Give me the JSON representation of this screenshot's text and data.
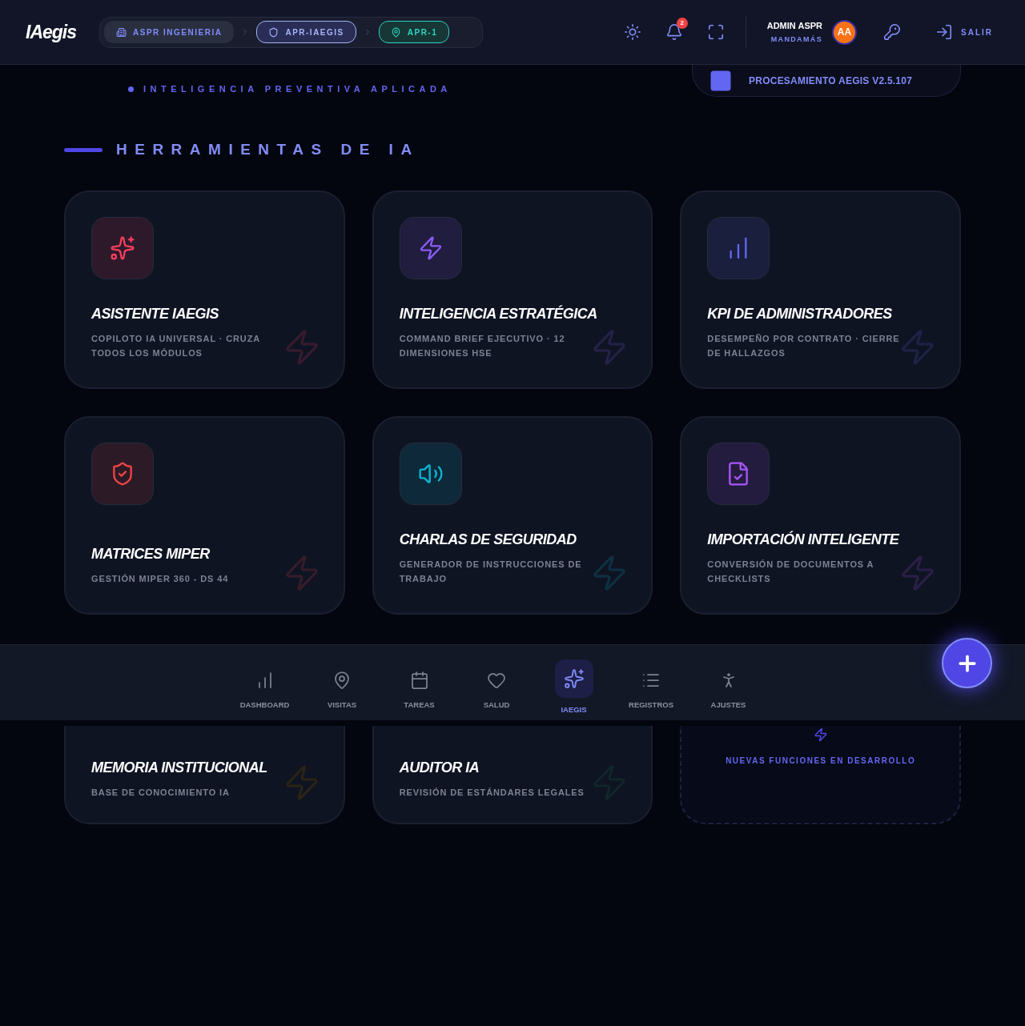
{
  "header": {
    "logo": "IAegis",
    "breadcrumbs": [
      {
        "label": "ASPR INGENIERIA",
        "kind": "company"
      },
      {
        "label": "APR-IAEGIS",
        "kind": "module"
      },
      {
        "label": "APR-1",
        "kind": "site"
      }
    ],
    "notifications": "2",
    "user": {
      "name": "ADMIN ASPR",
      "role": "MANDAMÁS",
      "initials": "AA"
    },
    "logout": "SALIR"
  },
  "tagline": "INTELIGENCIA PREVENTIVA APLICADA",
  "status_card": {
    "text": "PROCESAMIENTO AEGIS V2.5.107"
  },
  "section_title": "HERRAMIENTAS DE IA",
  "tools": [
    {
      "title": "ASISTENTE IAEGIS",
      "subtitle": "COPILOTO IA UNIVERSAL · CRUZA TODOS LOS MÓDULOS",
      "color": "#f43f5e"
    },
    {
      "title": "INTELIGENCIA ESTRATÉGICA",
      "subtitle": "COMMAND BRIEF EJECUTIVO · 12 DIMENSIONES HSE",
      "color": "#8b5cf6"
    },
    {
      "title": "KPI DE ADMINISTRADORES",
      "subtitle": "DESEMPEÑO POR CONTRATO · CIERRE DE HALLAZGOS",
      "color": "#6366f1"
    },
    {
      "title": "MATRICES MIPER",
      "subtitle": "GESTIÓN MIPER 360 - DS 44",
      "color": "#ef4444"
    },
    {
      "title": "CHARLAS DE SEGURIDAD",
      "subtitle": "GENERADOR DE INSTRUCCIONES DE TRABAJO",
      "color": "#06b6d4"
    },
    {
      "title": "IMPORTACIÓN INTELIGENTE",
      "subtitle": "CONVERSIÓN DE DOCUMENTOS A CHECKLISTS",
      "color": "#a855f7"
    },
    {
      "title": "MEMORIA INSTITUCIONAL",
      "subtitle": "BASE DE CONOCIMIENTO IA",
      "color": "#2b2414"
    },
    {
      "title": "AUDITOR IA",
      "subtitle": "REVISIÓN DE ESTÁNDARES LEGALES",
      "color": "#10272a"
    }
  ],
  "upcoming": {
    "text": "NUEVAS FUNCIONES EN DESARROLLO"
  },
  "bottom_nav": [
    {
      "label": "DASHBOARD",
      "selected": false
    },
    {
      "label": "VISITAS",
      "selected": false
    },
    {
      "label": "TAREAS",
      "selected": false
    },
    {
      "label": "SALUD",
      "selected": false
    },
    {
      "label": "IAEGIS",
      "selected": true
    },
    {
      "label": "REGISTROS",
      "selected": false
    },
    {
      "label": "AJUSTES",
      "selected": false
    }
  ]
}
